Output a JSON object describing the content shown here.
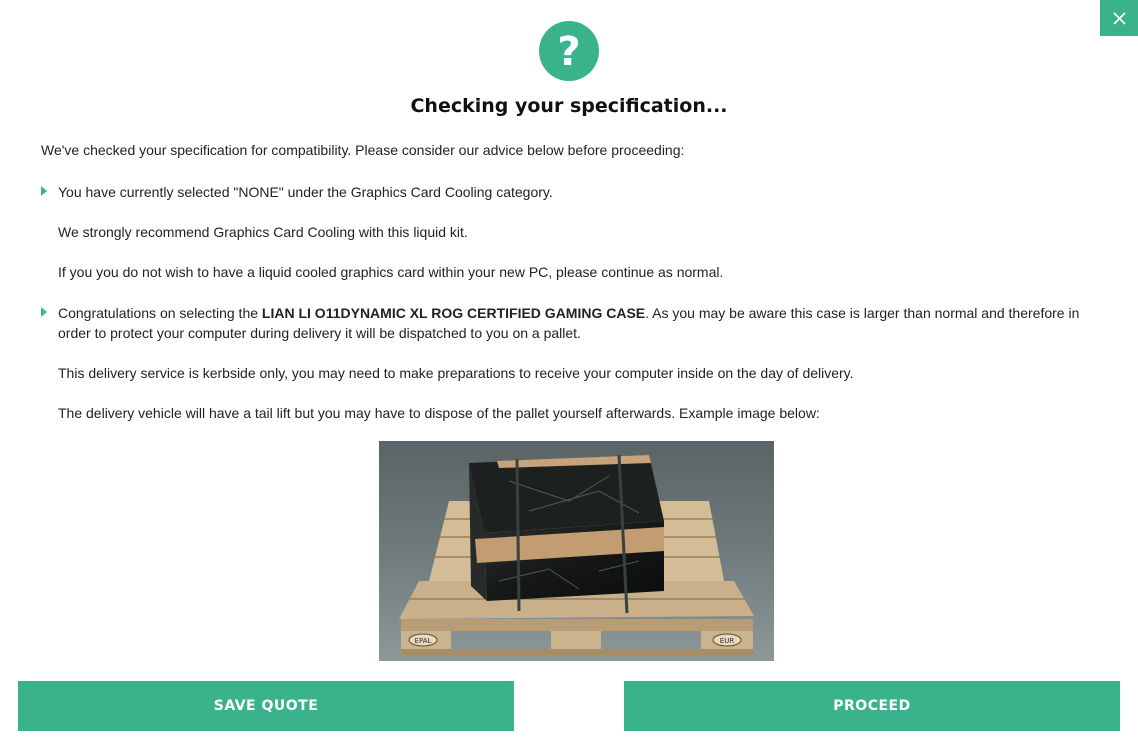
{
  "dialog": {
    "title": "Checking your specification...",
    "intro": "We've checked your specification for compatibility. Please consider our advice below before proceeding:"
  },
  "advice": [
    {
      "paragraphs": [
        "You have currently selected \"NONE\" under the Graphics Card Cooling category.",
        "We strongly recommend Graphics Card Cooling with this liquid kit.",
        "If you you do not wish to have a liquid cooled graphics card within your new PC, please continue as normal."
      ]
    },
    {
      "lead": "Congratulations on selecting the ",
      "product": "LIAN LI O11DYNAMIC XL ROG CERTIFIED GAMING CASE",
      "rest": ". As you may be aware this case is larger than normal and therefore in order to protect your computer during delivery it will be dispatched to you on a pallet.",
      "paragraphs": [
        "This delivery service is kerbside only, you may need to make preparations to receive your computer inside on the day of delivery.",
        "The delivery vehicle will have a tail lift but you may have to dispose of the pallet yourself afterwards. Example image below:"
      ]
    }
  ],
  "image": {
    "pallet_label": "EPAL",
    "pallet_label_right": "EUR"
  },
  "buttons": {
    "save": "SAVE QUOTE",
    "proceed": "PROCEED"
  },
  "icons": {
    "close": "close-icon",
    "help": "question-mark-icon",
    "bullet": "triangle-right-icon"
  },
  "colors": {
    "accent": "#3ab38c"
  }
}
